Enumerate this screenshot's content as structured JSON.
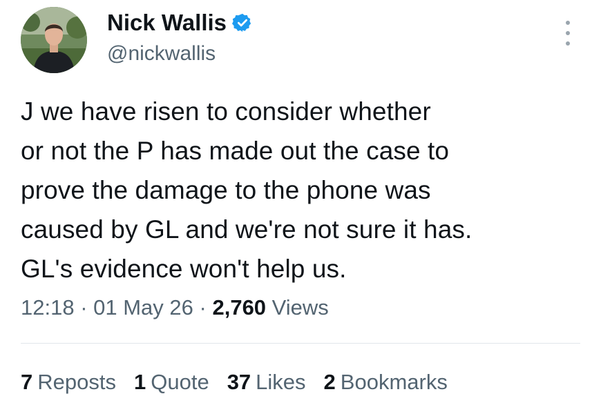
{
  "author": {
    "display_name": "Nick Wallis",
    "handle": "@nickwallis",
    "verified": true,
    "verified_color": "#1d9bf0"
  },
  "tweet": {
    "text": "J we have risen to consider whether\nor not the P has made out the case to\nprove the damage to the phone was\ncaused by GL and we're not sure it has.\nGL's evidence won't help us."
  },
  "meta": {
    "time": "12:18",
    "separator": " · ",
    "date": "01 May 26",
    "views_count": "2,760",
    "views_label": "Views"
  },
  "stats": [
    {
      "count": "7",
      "label": "Reposts"
    },
    {
      "count": "1",
      "label": "Quote"
    },
    {
      "count": "37",
      "label": "Likes"
    },
    {
      "count": "2",
      "label": "Bookmarks"
    }
  ],
  "icons": {
    "verified": "verified-badge-icon",
    "more": "more-vertical-icon"
  }
}
